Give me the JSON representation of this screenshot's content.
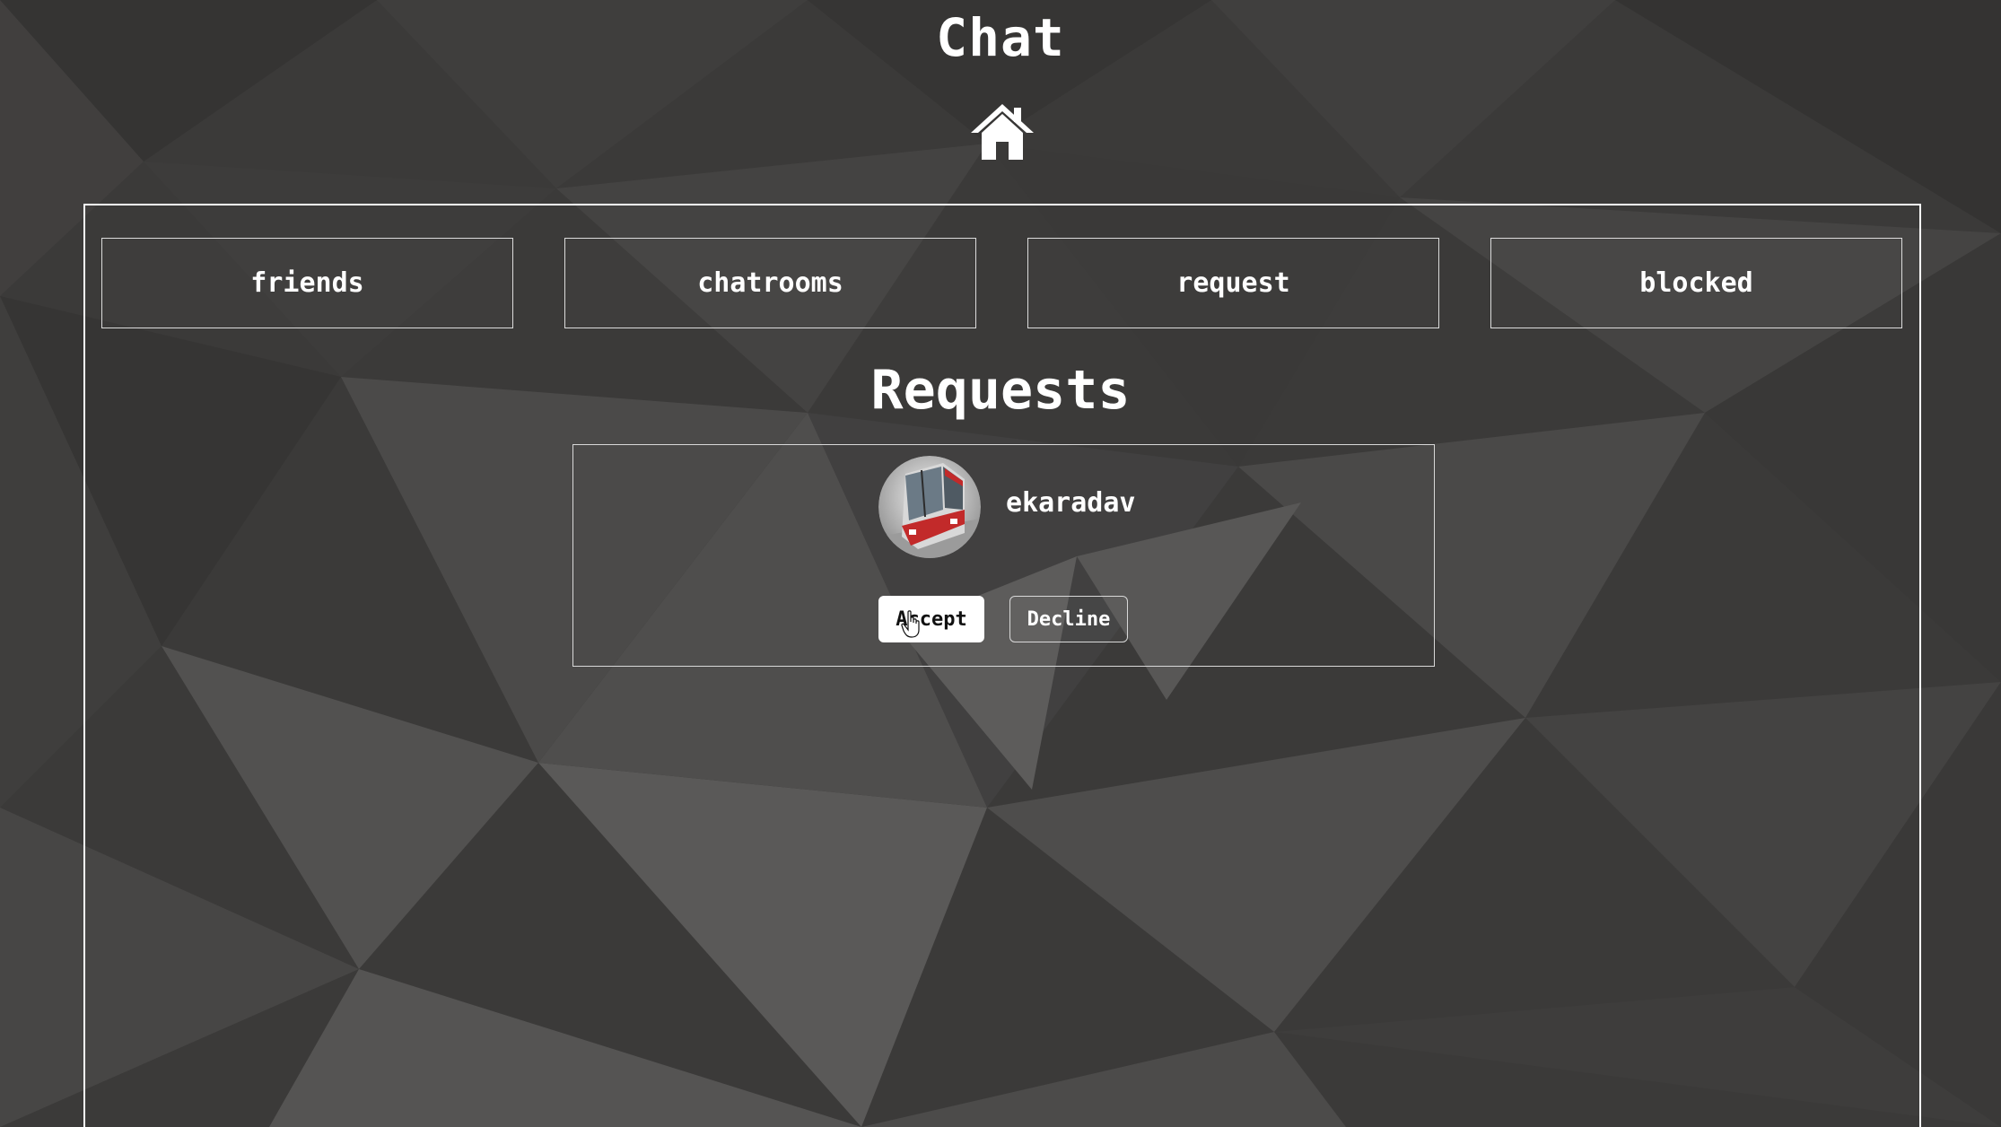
{
  "header": {
    "title": "Chat",
    "home_icon": "home-icon"
  },
  "tabs": [
    {
      "label": "friends"
    },
    {
      "label": "chatrooms"
    },
    {
      "label": "request"
    },
    {
      "label": "blocked"
    }
  ],
  "requests": {
    "title": "Requests",
    "items": [
      {
        "username": "ekaradav",
        "avatar_icon": "tram-avatar",
        "accept_label": "Accept",
        "decline_label": "Decline"
      }
    ]
  },
  "colors": {
    "background": "#3a3938",
    "text": "#ffffff",
    "border": "#dcdcdc",
    "accent": "#c22a2a"
  }
}
